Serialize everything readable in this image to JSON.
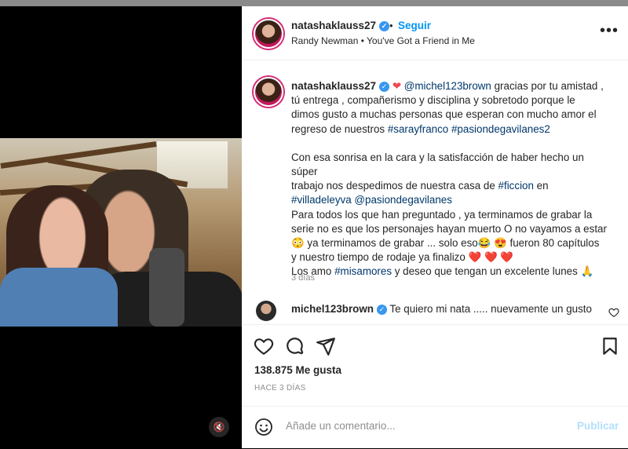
{
  "post": {
    "username": "natashaklauss27",
    "follow_label": "Seguir",
    "separator": "•",
    "song": "Randy Newman • You've Got a Friend in Me",
    "more_label": "•••",
    "caption": {
      "line1_mention": "@michel123brown",
      "line1_rest": " gracias por tu amistad ,",
      "line2": "tú entrega , compañerismo y disciplina y sobretodo porque le",
      "line3": "dimos gusto a muchas personas que esperan con mucho amor el",
      "line4_text": "regreso de nuestros ",
      "tag_sarayfranco": "#sarayfranco",
      "tag_pasiondegavilanes2": "#pasiondegavilanes2",
      "line5": "Con esa sonrisa en la cara y la satisfacción de haber hecho un súper",
      "line6_text": "trabajo nos despedimos de nuestra casa de ",
      "tag_ficcion": "#ficcion",
      "line6_end": " en",
      "tag_villadeleyva": "#villadeleyva",
      "mention_pasiondegavilanes": "@pasiondegavilanes",
      "line8": "Para todos los que han preguntado , ya terminamos de grabar la",
      "line9": "serie no es que los personajes hayan muerto O no vayamos a estar",
      "line10_a": "😳 ya terminamos de grabar ... solo eso😂 😍 fueron 80 capítulos",
      "line11_a": "y nuestro tiempo de rodaje ya finalizo ",
      "hearts": "❤️ ❤️ ❤️",
      "line12_a": "Los amo ",
      "tag_misamores": "#misamores",
      "line12_b": " y deseo que tengan un excelente lunes 🙏",
      "time": "3 días"
    },
    "comment": {
      "username": "michel123brown",
      "text": "Te quiero mi nata ..... nuevamente un gusto"
    },
    "likes": "138.875 Me gusta",
    "posted_ago": "HACE 3 DÍAS",
    "add_comment_placeholder": "Añade un comentario...",
    "publish_label": "Publicar"
  },
  "icons": [
    "like-heart-icon",
    "comment-icon",
    "share-icon",
    "save-bookmark-icon",
    "emoji-icon",
    "mute-icon",
    "verified-badge-icon"
  ],
  "colors": {
    "accent": "#0095f6",
    "heart": "#ed4956",
    "link": "#00376b"
  }
}
